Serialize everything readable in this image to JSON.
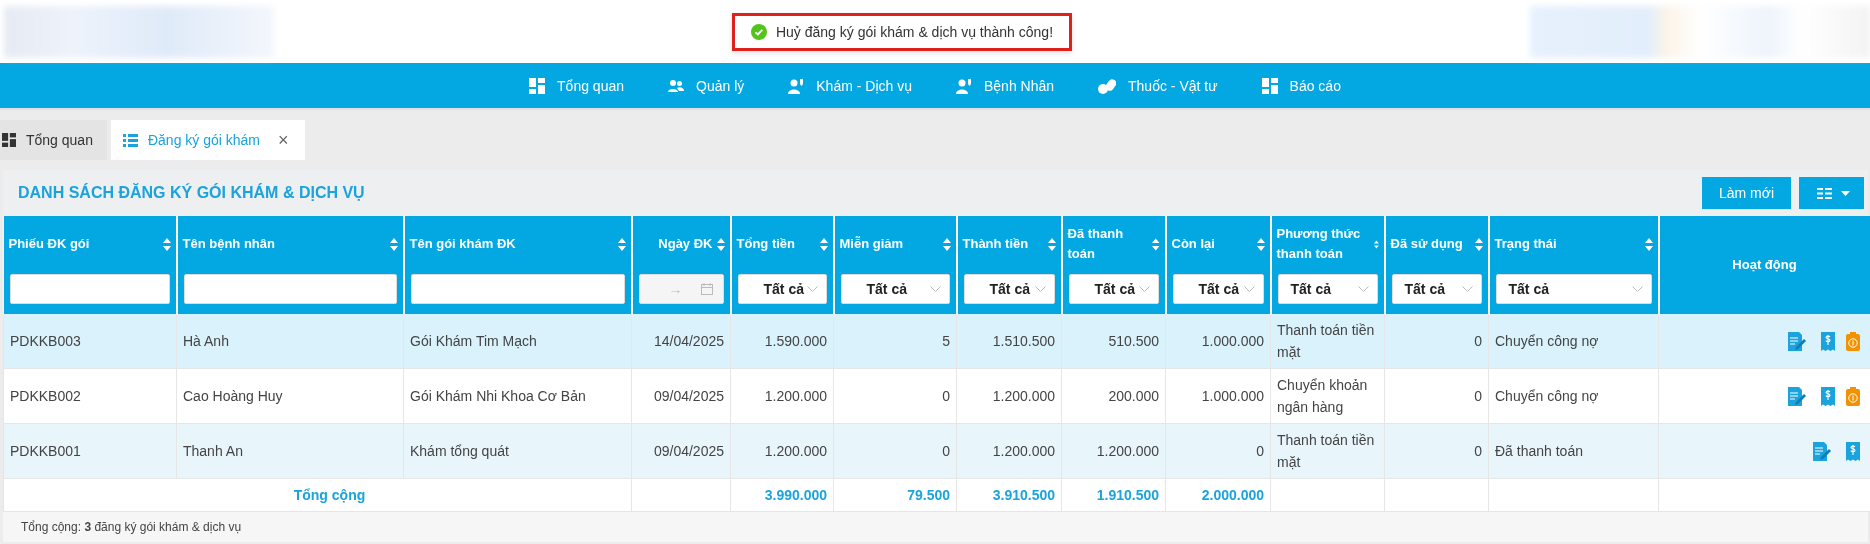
{
  "toast": {
    "message": "Huỷ đăng ký gói khám & dịch vụ thành công!",
    "highlighted": true
  },
  "nav": [
    {
      "label": "Tổng quan"
    },
    {
      "label": "Quản lý"
    },
    {
      "label": "Khám - Dịch vụ"
    },
    {
      "label": "Bệnh Nhân"
    },
    {
      "label": "Thuốc - Vật tư"
    },
    {
      "label": "Báo cáo"
    }
  ],
  "tabs": [
    {
      "label": "Tổng quan",
      "selected": false,
      "closable": false
    },
    {
      "label": "Đăng ký gói khám",
      "selected": true,
      "closable": true
    }
  ],
  "close_glyph": "×",
  "panel": {
    "title": "DANH SÁCH ĐĂNG KÝ GÓI KHÁM & DỊCH VỤ",
    "refresh_button": "Làm mới"
  },
  "table": {
    "columns": [
      {
        "label": "Phiếu ĐK gói",
        "kind": "text",
        "sortable": true
      },
      {
        "label": "Tên bệnh nhân",
        "kind": "text",
        "sortable": true
      },
      {
        "label": "Tên gói khám ĐK",
        "kind": "text",
        "sortable": true
      },
      {
        "label": "Ngày ĐK",
        "kind": "date",
        "sortable": true,
        "date_arrow": "→"
      },
      {
        "label": "Tổng tiền",
        "kind": "select",
        "value": "Tất cả",
        "sortable": true
      },
      {
        "label": "Miễn giảm",
        "kind": "select",
        "value": "Tất cả",
        "sortable": true
      },
      {
        "label": "Thành tiền",
        "kind": "select",
        "value": "Tất cả",
        "sortable": true
      },
      {
        "label": "Đã thanh toán",
        "kind": "select",
        "value": "Tất cả",
        "sortable": true
      },
      {
        "label": "Còn lại",
        "kind": "select",
        "value": "Tất cả",
        "sortable": true
      },
      {
        "label": "Phương thức thanh toán",
        "kind": "select",
        "value": "Tất cả",
        "sortable": true
      },
      {
        "label": "Đã sử dụng",
        "kind": "select",
        "value": "Tất cả",
        "sortable": true
      },
      {
        "label": "Trạng thái",
        "kind": "select",
        "value": "Tất cả",
        "sortable": true
      },
      {
        "label": "Hoạt động",
        "kind": "none",
        "sortable": false
      }
    ],
    "rows": [
      {
        "selected": true,
        "cells": [
          "PDKKB003",
          "Hà Anh",
          "Gói Khám Tim Mạch",
          "14/04/2025",
          "1.590.000",
          "5",
          "1.510.500",
          "510.500",
          "1.000.000",
          "Thanh toán tiền mặt",
          "0",
          "Chuyển công nợ"
        ],
        "actions": [
          {
            "kind": "edit"
          },
          {
            "kind": "receipt"
          },
          {
            "kind": "payment"
          }
        ]
      },
      {
        "selected": false,
        "cells": [
          "PDKKB002",
          "Cao Hoàng Huy",
          "Gói Khám Nhi Khoa Cơ Bản",
          "09/04/2025",
          "1.200.000",
          "0",
          "1.200.000",
          "200.000",
          "1.000.000",
          "Chuyển khoản ngân hàng",
          "0",
          "Chuyển công nợ"
        ],
        "actions": [
          {
            "kind": "edit"
          },
          {
            "kind": "receipt"
          },
          {
            "kind": "payment"
          }
        ]
      },
      {
        "selected": false,
        "cells": [
          "PDKKB001",
          "Thanh An",
          "Khám tổng quát",
          "09/04/2025",
          "1.200.000",
          "0",
          "1.200.000",
          "1.200.000",
          "0",
          "Thanh toán tiền mặt",
          "0",
          "Đã thanh toán"
        ],
        "actions": [
          {
            "kind": "edit"
          },
          {
            "kind": "receipt"
          }
        ]
      }
    ],
    "totals": {
      "label": "Tổng cộng",
      "values": [
        "3.990.000",
        "79.500",
        "3.910.500",
        "1.910.500",
        "2.000.000"
      ]
    }
  },
  "footer": "Tổng cộng: **3** đăng ký gói khám & dịch vụ"
}
